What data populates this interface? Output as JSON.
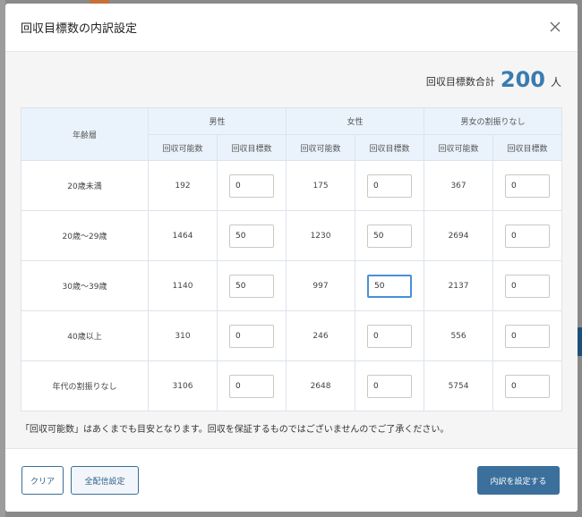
{
  "modal": {
    "title": "回収目標数の内訳設定"
  },
  "total": {
    "label": "回収目標数合計",
    "value": "200",
    "unit": "人"
  },
  "table": {
    "age_header": "年齢層",
    "groups": [
      "男性",
      "女性",
      "男女の割振りなし"
    ],
    "sub_headers": {
      "possible": "回収可能数",
      "target": "回収目標数"
    },
    "rows": [
      {
        "age": "20歳未満",
        "male_possible": "192",
        "male_target": "0",
        "female_possible": "175",
        "female_target": "0",
        "none_possible": "367",
        "none_target": "0"
      },
      {
        "age": "20歳～29歳",
        "male_possible": "1464",
        "male_target": "50",
        "female_possible": "1230",
        "female_target": "50",
        "none_possible": "2694",
        "none_target": "0"
      },
      {
        "age": "30歳～39歳",
        "male_possible": "1140",
        "male_target": "50",
        "female_possible": "997",
        "female_target": "50",
        "none_possible": "2137",
        "none_target": "0"
      },
      {
        "age": "40歳以上",
        "male_possible": "310",
        "male_target": "0",
        "female_possible": "246",
        "female_target": "0",
        "none_possible": "556",
        "none_target": "0"
      },
      {
        "age": "年代の割振りなし",
        "male_possible": "3106",
        "male_target": "0",
        "female_possible": "2648",
        "female_target": "0",
        "none_possible": "5754",
        "none_target": "0"
      }
    ]
  },
  "note": "「回収可能数」はあくまでも目安となります。回収を保証するものではございませんのでご了承ください。",
  "footer": {
    "clear_label": "クリア",
    "all_label": "全配信設定",
    "submit_label": "内訳を設定する"
  },
  "colors": {
    "accent": "#3a7bb0",
    "primary_button": "#3b6f9c",
    "header_bg": "#eaf3fb"
  },
  "icons": {
    "close": "close-icon"
  }
}
